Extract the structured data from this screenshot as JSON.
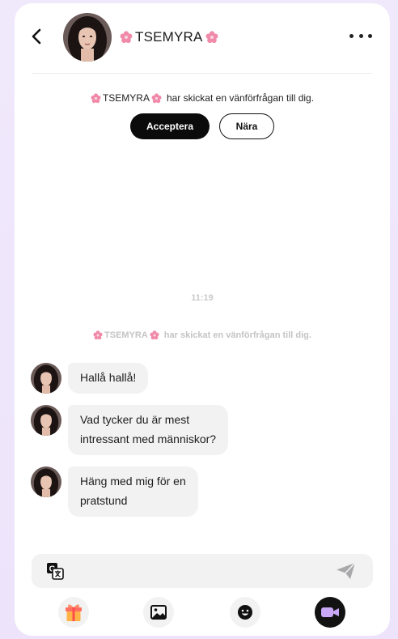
{
  "header": {
    "name": "TSEMYRA",
    "back_icon": "chevron-left-icon",
    "more_icon": "more-horizontal-icon",
    "flower_icon": "cherry-blossom-icon"
  },
  "friend_request": {
    "name": "TSEMYRA",
    "text": "har skickat en vänförfrågan till dig.",
    "accept_label": "Acceptera",
    "near_label": "Nära"
  },
  "chat": {
    "timestamp": "11:19",
    "system_note": {
      "name": "TSEMYRA",
      "text": "har skickat en vänförfrågan till dig."
    },
    "messages": [
      {
        "line1": "Hallå hallå!",
        "line2": ""
      },
      {
        "line1": "Vad tycker du är mest",
        "line2": "intressant med människor?"
      },
      {
        "line1": "Häng med mig för en",
        "line2": "pratstund"
      }
    ]
  },
  "composer": {
    "placeholder": "",
    "translate_icon": "translate-icon",
    "send_icon": "send-icon"
  },
  "toolbar": {
    "items": [
      {
        "icon": "gift-icon"
      },
      {
        "icon": "image-icon"
      },
      {
        "icon": "emoji-icon"
      },
      {
        "icon": "video-call-icon"
      }
    ]
  },
  "colors": {
    "background": "#efe7fb",
    "bubble": "#f2f2f3",
    "accept_button": "#0b0b0b",
    "blossom": "#f08aa8",
    "video_icon": "#c9a8f5"
  }
}
